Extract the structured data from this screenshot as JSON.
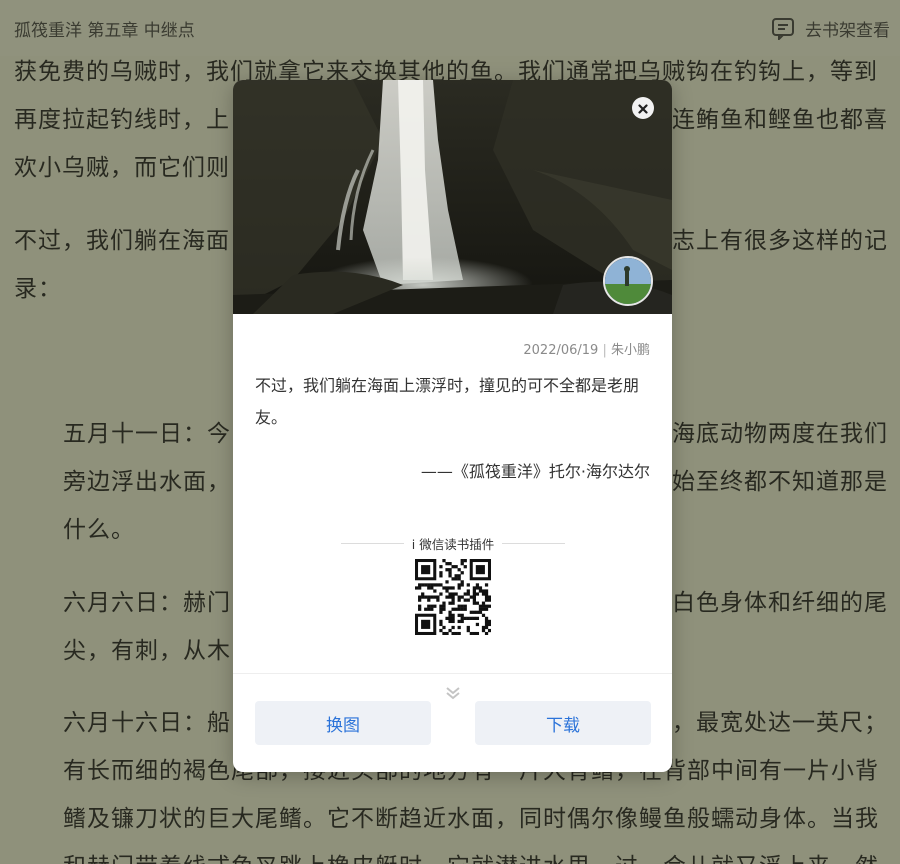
{
  "topbar": {
    "book_title": "孤筏重洋  第五章  中继点",
    "shelf_label": "去书架查看",
    "shelf_icon": "bookshelf-icon"
  },
  "reader": {
    "lines": [
      "获免费的乌贼时，我们就拿它来交换其他的鱼。我们通常把乌贼钩在钓钩上，等到",
      "再度拉起钓线时，上",
      "连鲔鱼和鲣鱼也都喜",
      "欢小乌贼，而它们则",
      "不过，我们躺在海面",
      "志上有很多这样的记",
      "录：",
      "五月十一日：今",
      "海底动物两度在我们",
      "旁边浮出水面，",
      "始至终都不知道那是",
      "什么。",
      "六月六日：赫门",
      "白色身体和纤细的尾",
      "尖，有刺，从木",
      "六月十六日：船",
      "，最宽处达一英尺；",
      "有长而细的褐色尾部，接近头部的地方有一片大背鳍，在背部中间有一片小背",
      "鳍及镰刀状的巨大尾鳍。它不断趋近水面，同时偶尔像鳗鱼般蠕动身体。当我",
      "和赫门带着线式鱼叉跳上橡皮艇时，它就潜进水里，过一会儿就又浮上来。然"
    ]
  },
  "card": {
    "date": "2022/06/19",
    "author": "朱小鹏",
    "quote": "不过，我们躺在海面上漂浮时，撞见的可不全都是老朋友。",
    "attribution": "——《孤筏重洋》托尔·海尔达尔",
    "plugin_label": "i 微信读书插件",
    "change_image_label": "换图",
    "download_label": "下载"
  }
}
